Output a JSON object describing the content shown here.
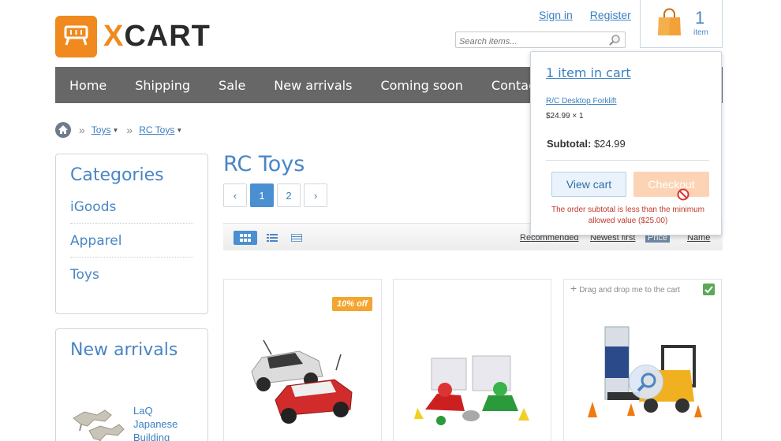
{
  "logo": {
    "text_x": "X",
    "text_rest": "CART"
  },
  "header": {
    "sign_in": "Sign in",
    "register": "Register",
    "search_placeholder": "Search items...",
    "cart_count": "1",
    "cart_label": "item"
  },
  "nav": {
    "items": [
      "Home",
      "Shipping",
      "Sale",
      "New arrivals",
      "Coming soon",
      "Contact us"
    ]
  },
  "breadcrumb": {
    "items": [
      "Toys",
      "RC Toys"
    ]
  },
  "sidebar": {
    "categories_title": "Categories",
    "categories": [
      "iGoods",
      "Apparel",
      "Toys"
    ],
    "new_arrivals_title": "New arrivals",
    "new_arrival_item": "LaQ Japanese Building"
  },
  "main": {
    "title": "RC Toys",
    "pager": {
      "prev": "‹",
      "pages": [
        "1",
        "2"
      ],
      "next": "›",
      "current": "1"
    },
    "sort_options": [
      "Recommended",
      "Newest first",
      "Price",
      "Name"
    ],
    "sort_active": "Price",
    "products": [
      {
        "badge": "10% off"
      },
      {},
      {
        "drag_hint": "Drag and drop me to the cart"
      }
    ]
  },
  "popup": {
    "title": "1 item in cart",
    "item_name": "R/C Desktop Forklift",
    "item_price": "$24.99 × 1",
    "subtotal_label": "Subtotal:",
    "subtotal_value": "$24.99",
    "view_cart": "View cart",
    "checkout": "Checkout",
    "error": "The order subtotal is less than the minimum allowed value ($25.00)"
  },
  "colors": {
    "accent": "#4a85c5",
    "brand_orange": "#f08a1e",
    "nav_bg": "#676767",
    "error": "#c0392b"
  },
  "icons": [
    "logo-cart-icon",
    "search-icon",
    "shopping-bag-icon",
    "home-icon",
    "grid-view-icon",
    "list-view-icon",
    "table-view-icon",
    "check-icon",
    "zoom-icon",
    "blocked-icon",
    "plus-icon"
  ]
}
